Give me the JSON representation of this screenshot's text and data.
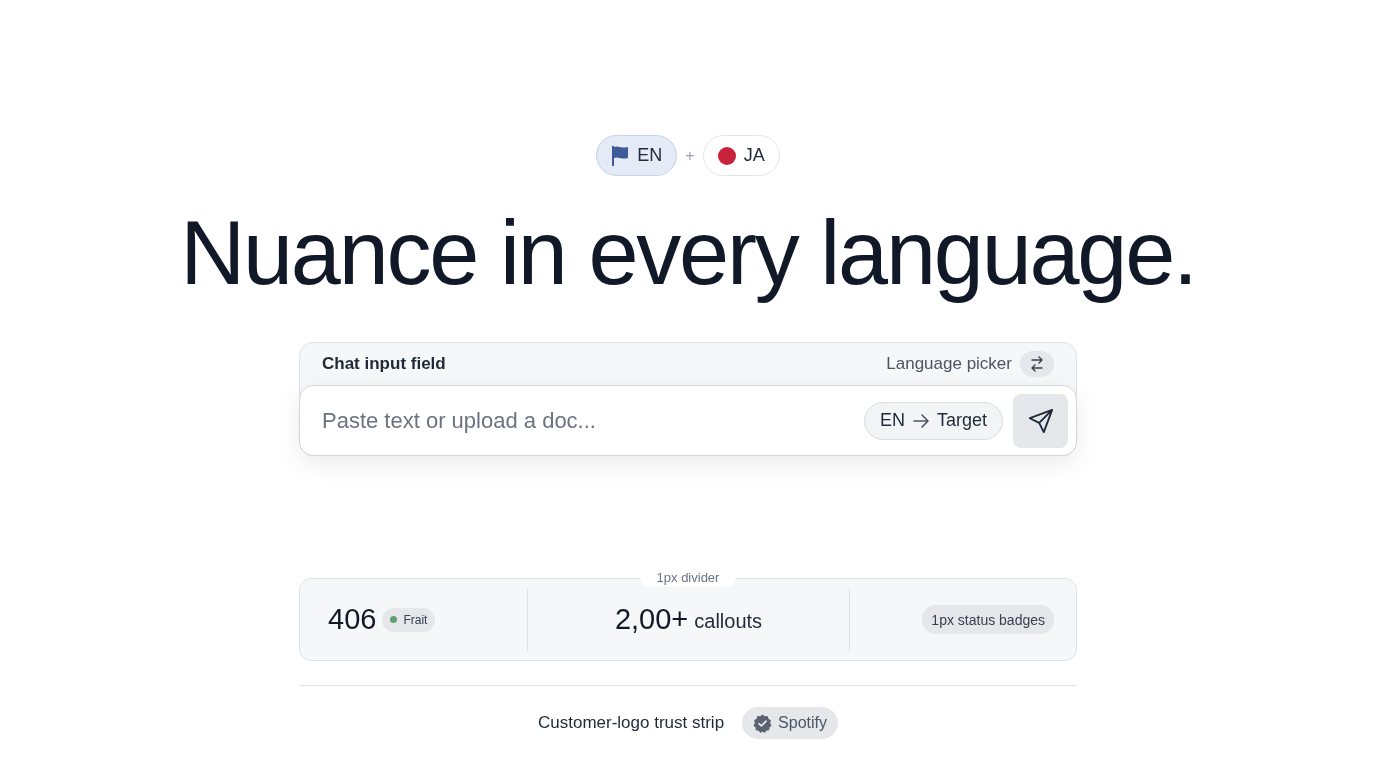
{
  "language_chips": {
    "items": [
      {
        "label": "EN",
        "kind": "flag",
        "selected": true
      },
      {
        "label": "JA",
        "kind": "dot",
        "selected": false
      }
    ],
    "separator": "+"
  },
  "headline": "Nuance in every language.",
  "chat_card": {
    "title": "Chat input field",
    "picker_label": "Language picker",
    "input": {
      "placeholder": "Paste text or upload a doc..."
    },
    "route": {
      "source": "EN",
      "target": "Target"
    }
  },
  "stats": {
    "caption": "1px divider",
    "items": [
      {
        "kind": "count",
        "value": "406",
        "badge": {
          "label": "Frait",
          "color": "#5f9e74"
        }
      },
      {
        "kind": "figure",
        "value": "2,00+",
        "label": "callouts"
      },
      {
        "kind": "badge",
        "label": "1px status badges"
      }
    ]
  },
  "trust_strip": {
    "label": "Customer-logo trust strip",
    "logos": [
      "Spotify"
    ]
  }
}
